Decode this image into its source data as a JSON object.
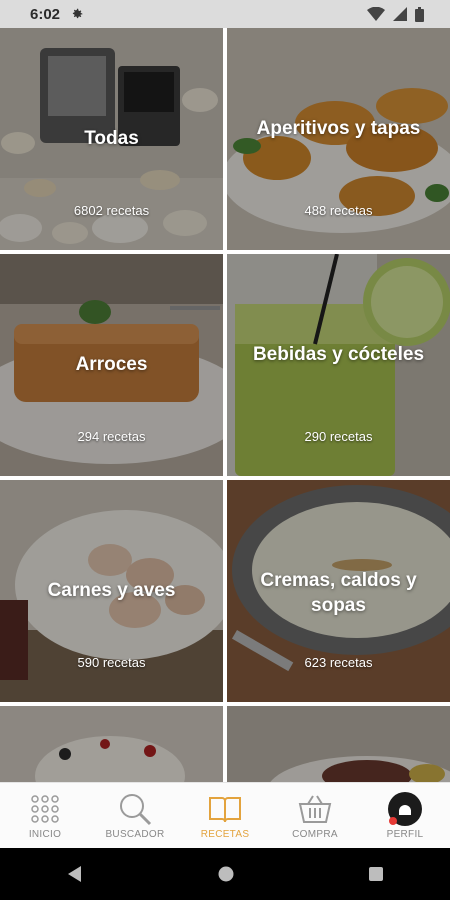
{
  "status": {
    "time": "6:02"
  },
  "categories": [
    {
      "title": "Todas",
      "count": "6802 recetas"
    },
    {
      "title": "Aperitivos y tapas",
      "count": "488 recetas"
    },
    {
      "title": "Arroces",
      "count": "294 recetas"
    },
    {
      "title": "Bebidas y cócteles",
      "count": "290 recetas"
    },
    {
      "title": "Carnes y aves",
      "count": "590 recetas"
    },
    {
      "title": "Cremas, caldos y sopas",
      "count": "623 recetas"
    }
  ],
  "tabs": [
    {
      "label": "INICIO",
      "icon": "grid-icon"
    },
    {
      "label": "BUSCADOR",
      "icon": "search-icon"
    },
    {
      "label": "RECETAS",
      "icon": "book-icon",
      "active": true
    },
    {
      "label": "COMPRA",
      "icon": "basket-icon"
    },
    {
      "label": "PERFIL",
      "icon": "profile-avatar"
    }
  ],
  "colors": {
    "accent": "#e3a33d",
    "status_bar": "#dcdcdc",
    "nav_bar": "#000000"
  }
}
